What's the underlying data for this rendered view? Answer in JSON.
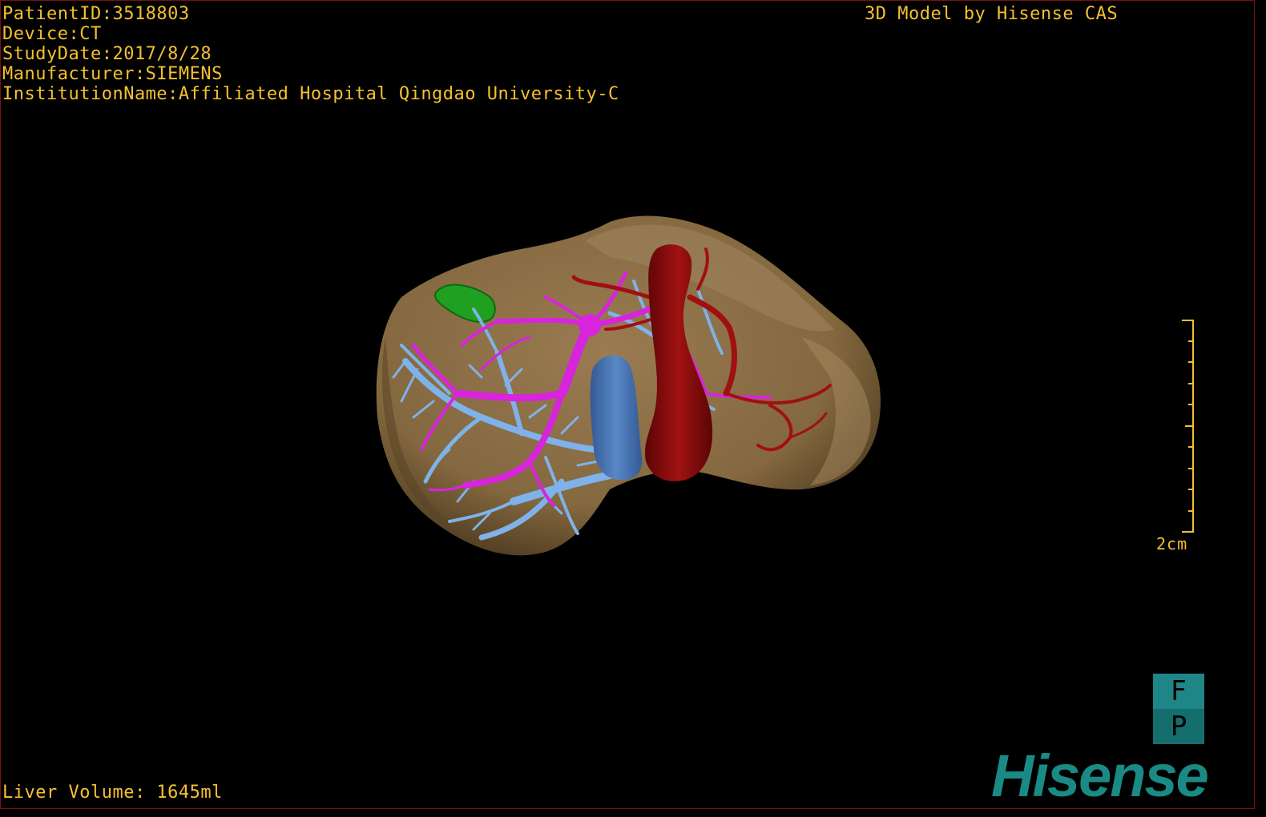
{
  "info": {
    "patient_id": "PatientID:3518803",
    "device": "Device:CT",
    "study_date": "StudyDate:2017/8/28",
    "manufacturer": "Manufacturer:SIEMENS",
    "institution": "InstitutionName:Affiliated Hospital Qingdao University-C"
  },
  "credit": "3D Model by Hisense CAS",
  "liver_volume": "Liver Volume: 1645ml",
  "scale_bar": {
    "label": "2cm"
  },
  "orientation": {
    "top": "F",
    "bottom": "P"
  },
  "logo": "Hisense",
  "colors": {
    "overlay_text": "#f5c030",
    "liver": "#8c7048",
    "portal_vein": "#d020d8",
    "hepatic_vein": "#78aee6",
    "ivc": "#4a78b8",
    "artery": "#8c0a0a",
    "gallbladder": "#1fa020",
    "brand": "#1a8a84"
  }
}
